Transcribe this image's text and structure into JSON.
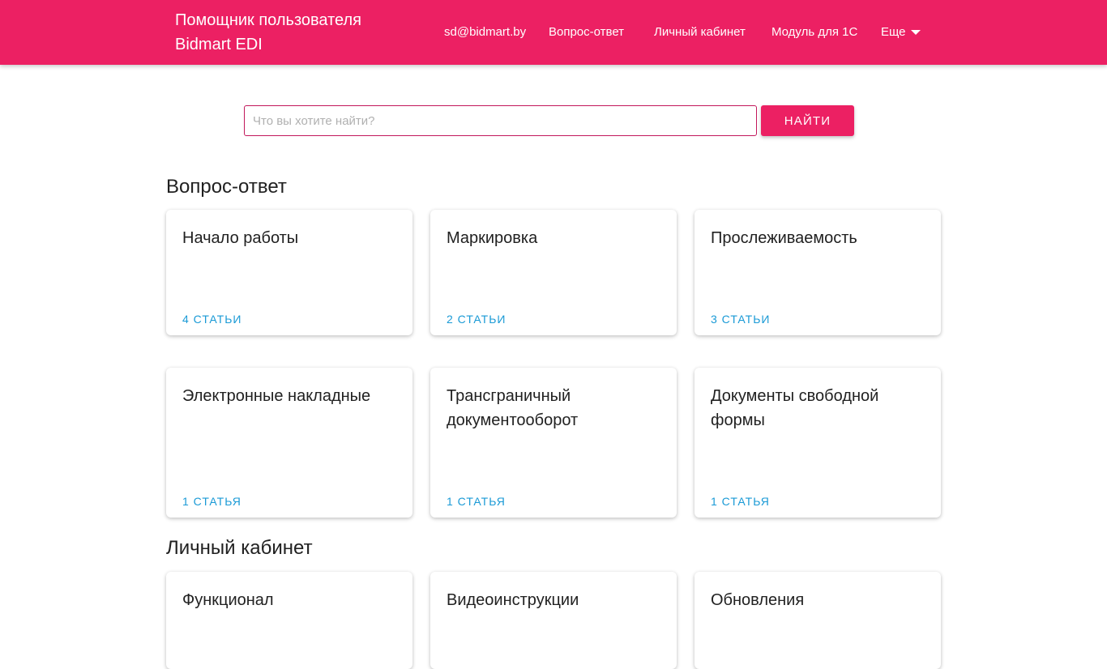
{
  "header": {
    "brand": "Помощник пользователя Bidmart EDI",
    "nav": {
      "email": "sd@bidmart.by",
      "faq": "Вопрос-ответ",
      "account": "Личный кабинет",
      "module_1c": "Модуль для 1С",
      "more": "Еще"
    },
    "accent_color": "#ec2063"
  },
  "search": {
    "placeholder": "Что вы хотите найти?",
    "value": "",
    "button_label": "Найти"
  },
  "sections": [
    {
      "title": "Вопрос-ответ",
      "cards": [
        {
          "title": "Начало работы",
          "count": "4 статьи"
        },
        {
          "title": "Маркировка",
          "count": "2 статьи"
        },
        {
          "title": "Прослеживаемость",
          "count": "3 статьи"
        },
        {
          "title": "Электронные накладные",
          "count": "1 статья"
        },
        {
          "title": "Трансграничный документооборот",
          "count": "1 статья"
        },
        {
          "title": "Документы свободной формы",
          "count": "1 статья"
        }
      ]
    },
    {
      "title": "Личный кабинет",
      "cards": [
        {
          "title": "Функционал"
        },
        {
          "title": "Видеоинструкции"
        },
        {
          "title": "Обновления"
        }
      ]
    }
  ],
  "link_color": "#1a9ad6"
}
